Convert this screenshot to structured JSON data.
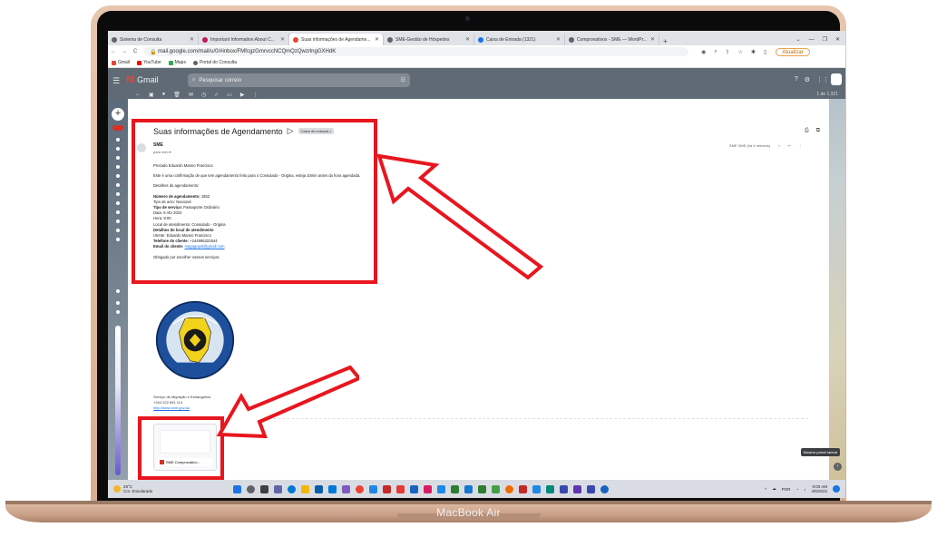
{
  "device": {
    "model": "MacBook Air"
  },
  "browser": {
    "tabs": [
      {
        "label": "Sistema de Consulta",
        "active": false
      },
      {
        "label": "Important Information About C...",
        "active": false
      },
      {
        "label": "Suas informações de Agendame...",
        "active": true
      },
      {
        "label": "SME-Gestão de Hóspedes",
        "active": false
      },
      {
        "label": "Caixa de Entrada (1321)",
        "active": false
      },
      {
        "label": "Comprovativos - SME — WordPr...",
        "active": false
      }
    ],
    "url": "mail.google.com/mail/u/0/#inbox/FMfcgzGmrvccNCQmQzQwzrlngGXHdK",
    "update_label": "Atualizar",
    "bookmarks": [
      "Gmail",
      "YouTube",
      "Maps",
      "Portal do Consulta"
    ]
  },
  "gmail": {
    "product": "Gmail",
    "search_placeholder": "Pesquisar correio",
    "pager": "1 de 1.321",
    "subject": "Suas informações de Agendamento",
    "label_chip": "Caixa de entrada ×",
    "sender": "SME",
    "to": "para mim ▾",
    "date": "SME SME (há 6 minutos)",
    "body": {
      "greeting": "Prezado Eduardo Mareio Francisco",
      "intro": "Este é uma confirmação de que tem agendamento feito para o Consulado - Origina, esteja 10min antes da hora agendada.",
      "details_title": "Detalhes do agendamento:",
      "fields": [
        {
          "key": "Número de agendamento:",
          "value": "1852",
          "bold_key": true
        },
        {
          "key": "Tipo de acto:",
          "value": "Nacional",
          "bold_key": false
        },
        {
          "key": "Tipo de serviço:",
          "value": "Passaporte Ordinário",
          "bold_key": true
        },
        {
          "key": "Data:",
          "value": "6 Abr 2022",
          "bold_key": false
        },
        {
          "key": "Hora:",
          "value": "9:00",
          "bold_key": false
        },
        {
          "key": "Local de atendimento:",
          "value": "Consulado - Origina",
          "bold_key": false
        },
        {
          "key": "Detalhes do local de atendimento",
          "value": "",
          "bold_key": true
        },
        {
          "key": "Utente:",
          "value": "Eduardo Mareio Francisco",
          "bold_key": false
        },
        {
          "key": "Telefone do cliente:",
          "value": "+244995322544",
          "bold_key": true
        },
        {
          "key": "Email do cliente:",
          "value": "magagopol@gmail.com",
          "bold_key": true,
          "link": true
        }
      ],
      "thanks": "Obrigado por escolher nossos serviços."
    },
    "seal_text": {
      "top": "MIGRAÇÃO E ESTRANGEIROS",
      "bottom": "ANGOLA"
    },
    "signature": [
      "Serviço de Migração e Estrangeiros",
      "+244 222 691 114"
    ],
    "signature_link": "http://www.sme.gov.ao",
    "attachment_name": "SME Comprovativo...",
    "side_tip": "Mostrar painel lateral"
  },
  "taskbar": {
    "weather_temp": "29°C",
    "weather_desc": "Cor. Ensolarado",
    "lang": "POR",
    "time": "9:00 AM",
    "date": "4/5/2022"
  },
  "colors": {
    "annotation": "#e8161e",
    "gmail_red": "#ea4335",
    "laptop_gold": "#e2bfa8"
  }
}
